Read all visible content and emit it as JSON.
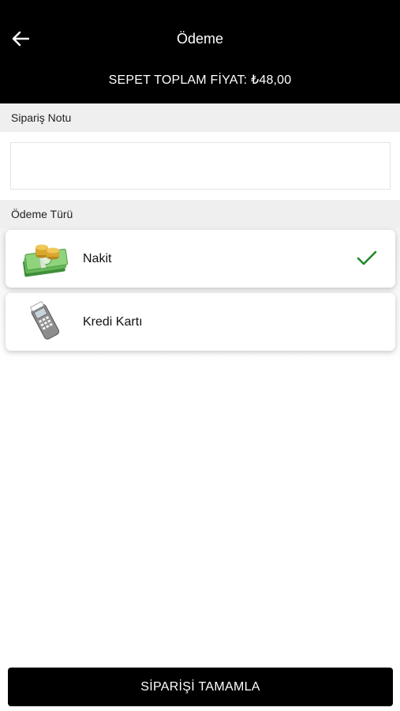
{
  "header": {
    "title": "Ödeme",
    "back_icon": "arrow-left-icon",
    "cart_total": "SEPET TOPLAM FİYAT: ₺48,00"
  },
  "order_note": {
    "label": "Sipariş Notu",
    "value": "",
    "placeholder": ""
  },
  "payment": {
    "label": "Ödeme Türü",
    "options": [
      {
        "label": "Nakit",
        "icon": "cash-money-icon",
        "selected": true
      },
      {
        "label": "Kredi Kartı",
        "icon": "card-terminal-icon",
        "selected": false
      }
    ],
    "selected_check_icon": "checkmark-icon"
  },
  "footer": {
    "complete_label": "SİPARİŞİ TAMAMLA"
  },
  "colors": {
    "header_bg": "#000000",
    "section_bg": "#efefef",
    "check_green": "#1e8a2a",
    "button_bg": "#000000"
  }
}
